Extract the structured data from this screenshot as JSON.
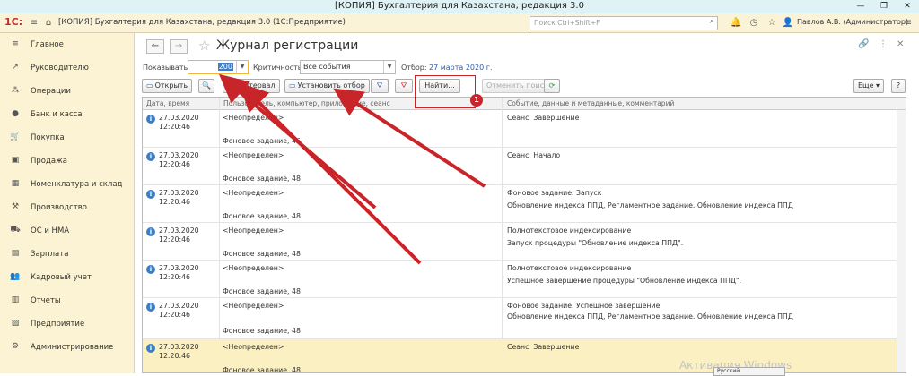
{
  "window": {
    "title": "[КОПИЯ] Бухгалтерия для Казахстана, редакция 3.0",
    "minimize": "—",
    "restore": "❐",
    "close": "✕"
  },
  "app": {
    "logo": "1С:",
    "title": "[КОПИЯ] Бухгалтерия для Казахстана, редакция 3.0  (1С:Предприятие)",
    "search_placeholder": "Поиск Ctrl+Shift+F",
    "user": "Павлов А.В. (Администратор)"
  },
  "sidebar": {
    "items": [
      {
        "icon": "≡",
        "label": "Главное"
      },
      {
        "icon": "↗",
        "label": "Руководителю"
      },
      {
        "icon": "⁂",
        "label": "Операции"
      },
      {
        "icon": "●",
        "label": "Банк и касса"
      },
      {
        "icon": "🛒",
        "label": "Покупка"
      },
      {
        "icon": "▣",
        "label": "Продажа"
      },
      {
        "icon": "▦",
        "label": "Номенклатура и склад"
      },
      {
        "icon": "⚒",
        "label": "Производство"
      },
      {
        "icon": "⛟",
        "label": "ОС и НМА"
      },
      {
        "icon": "▤",
        "label": "Зарплата"
      },
      {
        "icon": "👥",
        "label": "Кадровый учет"
      },
      {
        "icon": "▥",
        "label": "Отчеты"
      },
      {
        "icon": "▨",
        "label": "Предприятие"
      },
      {
        "icon": "⚙",
        "label": "Администрирование"
      }
    ]
  },
  "page": {
    "back": "←",
    "forward": "→",
    "star": "☆",
    "title": "Журнал регистрации",
    "link_icon": "🔗",
    "more_icon": "⋮",
    "close_icon": "✕"
  },
  "filters": {
    "show_label": "Показывать:",
    "show_value": "200",
    "criticality_label": "Критичность:",
    "criticality_value": "Все события",
    "selection_label": "Отбор:",
    "selection_value": "27 марта 2020 г."
  },
  "toolbar": {
    "open": "Открыть",
    "interval": "Интервал",
    "set_filter": "Установить отбор",
    "find": "Найти...",
    "cancel_search": "Отменить поиск",
    "more": "Еще",
    "help": "?"
  },
  "table": {
    "columns": [
      "Дата, время",
      "Пользователь, компьютер, приложение, сеанс",
      "Событие, данные и метаданные, комментарий"
    ],
    "rows": [
      {
        "date": "27.03.2020",
        "time": "12:20:46",
        "user": "<Неопределен>",
        "task": "Фоновое задание, 46",
        "event": "Сеанс. Завершение",
        "details": ""
      },
      {
        "date": "27.03.2020",
        "time": "12:20:46",
        "user": "<Неопределен>",
        "task": "Фоновое задание, 48",
        "event": "Сеанс. Начало",
        "details": ""
      },
      {
        "date": "27.03.2020",
        "time": "12:20:46",
        "user": "<Неопределен>",
        "task": "Фоновое задание, 48",
        "event": "Фоновое задание. Запуск",
        "details": "Обновление индекса ППД, Регламентное задание. Обновление индекса ППД"
      },
      {
        "date": "27.03.2020",
        "time": "12:20:46",
        "user": "<Неопределен>",
        "task": "Фоновое задание, 48",
        "event": "Полнотекстовое индексирование",
        "details": "Запуск процедуры \"Обновление индекса ППД\"."
      },
      {
        "date": "27.03.2020",
        "time": "12:20:46",
        "user": "<Неопределен>",
        "task": "Фоновое задание, 48",
        "event": "Полнотекстовое индексирование",
        "details": "Успешное завершение процедуры \"Обновление индекса ППД\"."
      },
      {
        "date": "27.03.2020",
        "time": "12:20:46",
        "user": "<Неопределен>",
        "task": "Фоновое задание, 48",
        "event": "Фоновое задание. Успешное завершение",
        "details": "Обновление индекса ППД, Регламентное задание. Обновление индекса ППД"
      },
      {
        "date": "27.03.2020",
        "time": "12:20:46",
        "user": "<Неопределен>",
        "task": "Фоновое задание, 48",
        "event": "Сеанс. Завершение",
        "details": ""
      }
    ]
  },
  "annotation": {
    "marker": "1"
  },
  "overlay": {
    "watermark": "Активация Windows",
    "language": "Русский"
  },
  "colors": {
    "arrow": "#c8252a",
    "selected_row": "#fbf0c2",
    "sidebar": "#fbf3d3",
    "accent_link": "#2a5db0"
  }
}
